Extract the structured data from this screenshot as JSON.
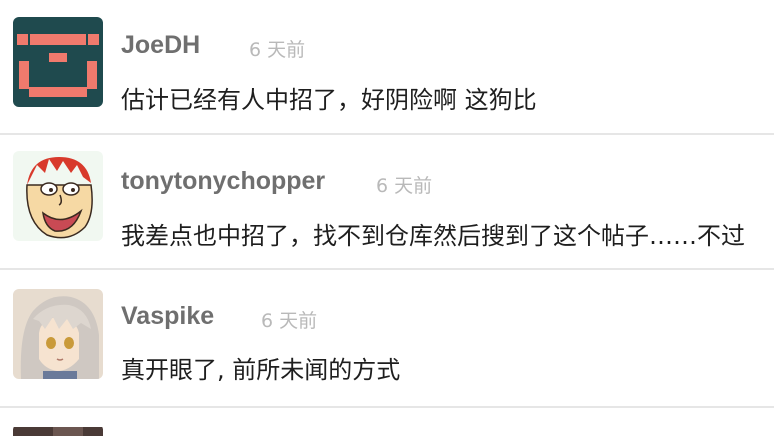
{
  "comments": [
    {
      "author": "JoeDH",
      "time": "6 天前",
      "text": "估计已经有人中招了，好阴险啊 这狗比",
      "avatar_icon": "pixel-face-icon",
      "avatar_color": "#1f4a4e"
    },
    {
      "author": "tonytonychopper",
      "time": "6 天前",
      "text": "我差点也中招了，找不到仓库然后搜到了这个帖子……不过",
      "avatar_icon": "cartoon-face-icon",
      "avatar_color": "#f1f8f1"
    },
    {
      "author": "Vaspike",
      "time": "6 天前",
      "text": "真开眼了, 前所未闻的方式",
      "avatar_icon": "anime-girl-icon",
      "avatar_color": "#e7dccf"
    }
  ],
  "colors": {
    "author": "#6f6f6f",
    "time": "#b9b9b9",
    "text": "#1e1e1e",
    "divider": "#e6e6e6"
  }
}
